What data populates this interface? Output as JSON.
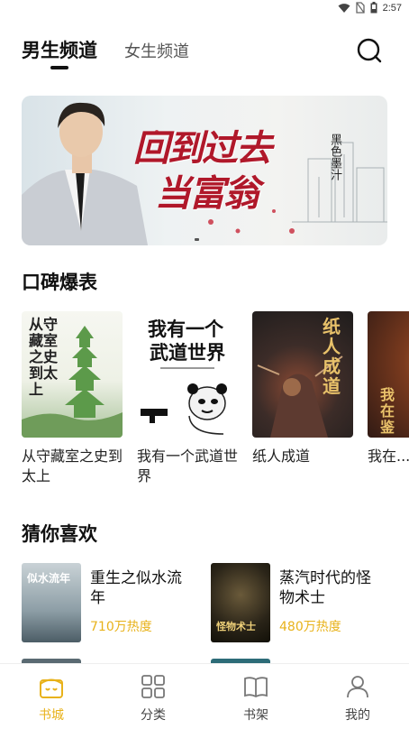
{
  "status_bar": {
    "time": "2:57",
    "icons": [
      "wifi-icon",
      "no-sim-icon",
      "battery-icon"
    ]
  },
  "channel_tabs": {
    "male": "男生频道",
    "female": "女生频道",
    "active": "male"
  },
  "banner": {
    "title_line1": "回到过去",
    "title_line2": "当富翁",
    "author": "黑色墨汁"
  },
  "koubei": {
    "title": "口碑爆表",
    "books": [
      {
        "title": "从守藏室之史到太上",
        "cover_text": "从守藏室之史到太上"
      },
      {
        "title": "我有一个武道世界",
        "cover_text_1": "我有一个",
        "cover_text_2": "武道世界"
      },
      {
        "title": "纸人成道",
        "cover_text": "纸人成道"
      },
      {
        "title": "我在...的那",
        "cover_text": "我在鉴"
      }
    ]
  },
  "guess": {
    "title": "猜你喜欢",
    "items": [
      {
        "title": "重生之似水流年",
        "heat": "710万热度",
        "cover_text": "似水流年"
      },
      {
        "title": "蒸汽时代的怪物术士",
        "heat": "480万热度",
        "cover_text": "怪物术士"
      }
    ]
  },
  "bottom_nav": {
    "items": [
      {
        "label": "书城",
        "icon": "bookstore-icon",
        "active": true
      },
      {
        "label": "分类",
        "icon": "category-grid-icon",
        "active": false
      },
      {
        "label": "书架",
        "icon": "bookshelf-icon",
        "active": false
      },
      {
        "label": "我的",
        "icon": "profile-icon",
        "active": false
      }
    ]
  },
  "colors": {
    "accent": "#e8b21a",
    "banner_title": "#b0182a"
  }
}
